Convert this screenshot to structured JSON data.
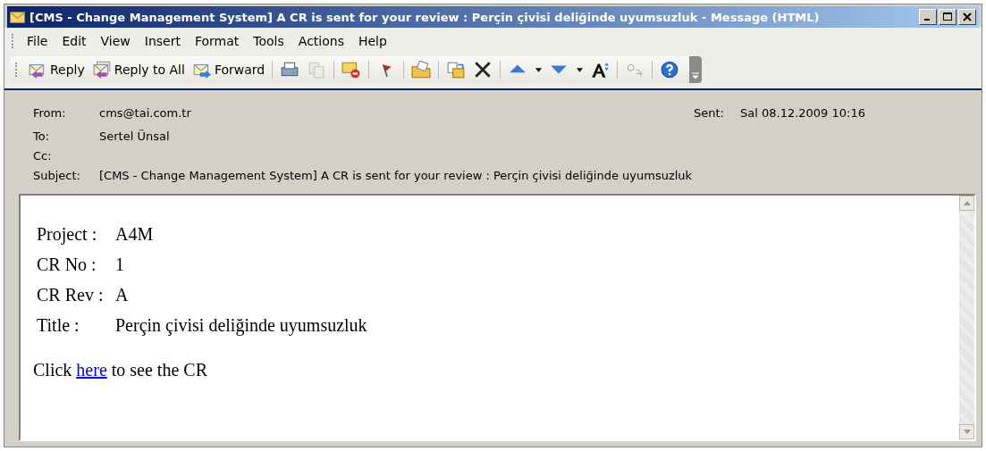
{
  "window": {
    "title": "[CMS - Change Management System] A CR is sent for your review : Perçin çivisi deliğinde uyumsuzluk - Message (HTML)"
  },
  "menu": [
    "File",
    "Edit",
    "View",
    "Insert",
    "Format",
    "Tools",
    "Actions",
    "Help"
  ],
  "toolbar": [
    {
      "kind": "text",
      "label": "Reply",
      "disabled": false
    },
    {
      "kind": "text",
      "label": "Reply to All",
      "disabled": false
    },
    {
      "kind": "text",
      "label": "Forward",
      "disabled": false
    },
    {
      "kind": "separator"
    },
    {
      "kind": "icon",
      "disabled": false
    },
    {
      "kind": "icon",
      "disabled": true
    },
    {
      "kind": "separator"
    },
    {
      "kind": "icon",
      "disabled": false
    },
    {
      "kind": "separator"
    },
    {
      "kind": "icon",
      "disabled": false
    },
    {
      "kind": "separator"
    },
    {
      "kind": "icon",
      "disabled": false
    },
    {
      "kind": "separator"
    },
    {
      "kind": "icon",
      "disabled": false
    },
    {
      "kind": "icon",
      "disabled": false
    },
    {
      "kind": "separator"
    },
    {
      "kind": "icon",
      "disabled": false
    },
    {
      "kind": "icon",
      "disabled": false
    },
    {
      "kind": "icon",
      "disabled": false
    },
    {
      "kind": "separator"
    },
    {
      "kind": "icon",
      "disabled": true
    },
    {
      "kind": "separator"
    },
    {
      "kind": "icon",
      "disabled": false
    }
  ],
  "header": {
    "from_label": "From:",
    "from": "cms@tai.com.tr",
    "sent_label": "Sent:",
    "sent": "Sal 08.12.2009 10:16",
    "to_label": "To:",
    "to": "Sertel Ünsal",
    "cc_label": "Cc:",
    "subject_label": "Subject:",
    "subject": "[CMS - Change Management System] A CR is sent for your review : Perçin çivisi deliğinde uyumsuzluk"
  },
  "body": {
    "fields": [
      {
        "label": "Project :",
        "value": "A4M"
      },
      {
        "label": "CR No :",
        "value": "1"
      },
      {
        "label": "CR Rev :",
        "value": "A"
      },
      {
        "label": "Title :",
        "value": "Perçin çivisi deliğinde uyumsuzluk"
      }
    ],
    "click_before": "Click",
    "link": "here",
    "click_after": "to see the CR"
  }
}
